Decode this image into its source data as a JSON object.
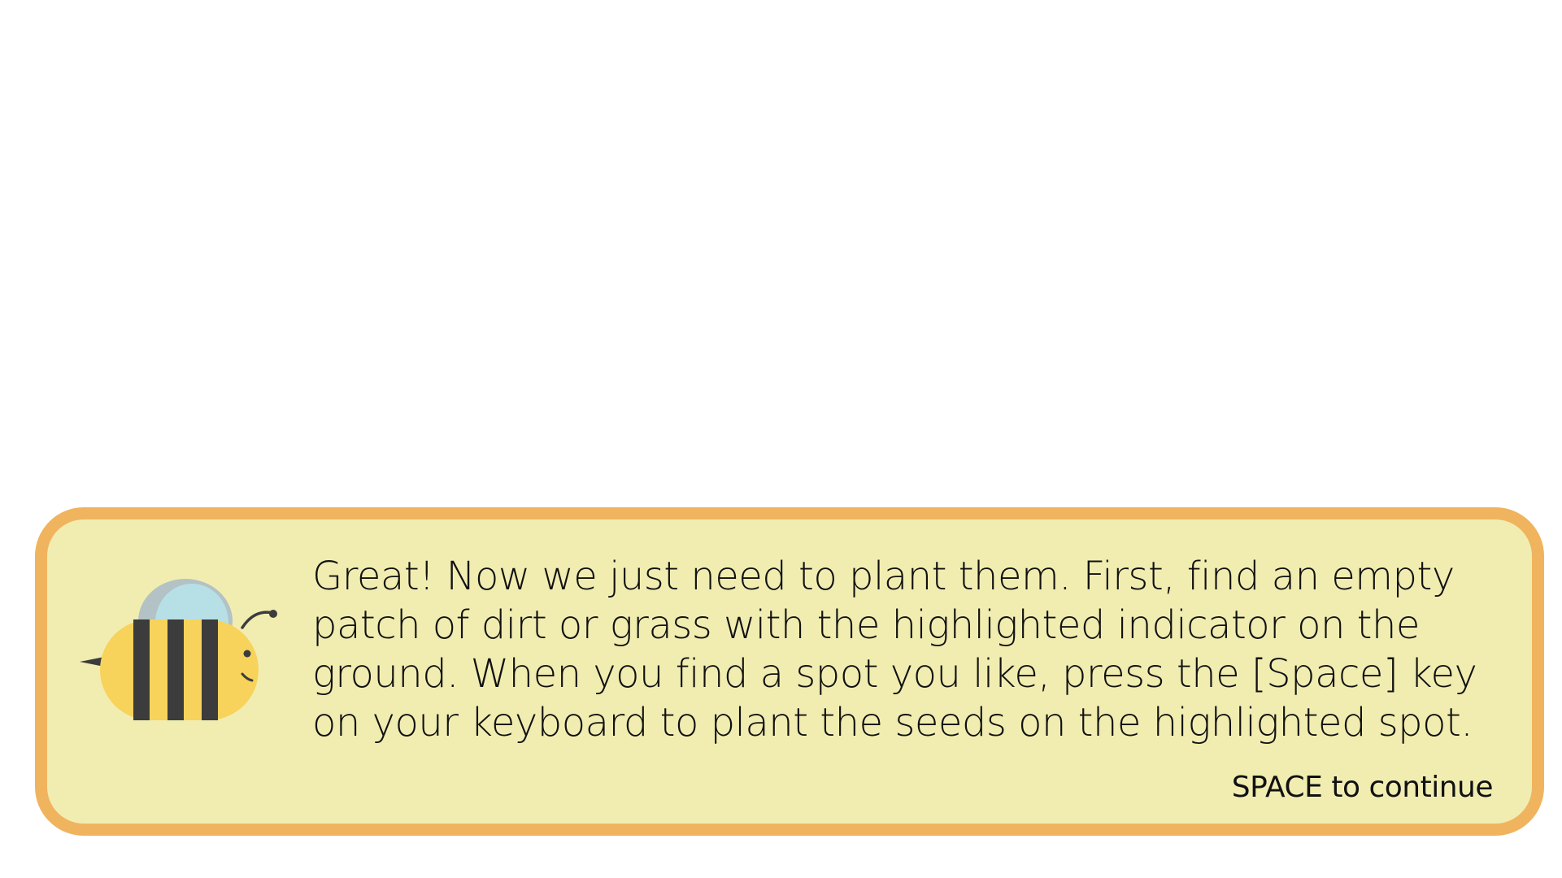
{
  "dialog": {
    "message": "Great! Now we just need to plant them. First, find an empty patch of dirt or grass with the highlighted indicator on the ground. When you find a spot you like, press the [Space] key on your keyboard to plant the seeds on the highlighted spot.",
    "continue_hint": "SPACE to continue",
    "speaker_icon": "bee-icon"
  },
  "colors": {
    "background": "#ffffff",
    "dialog_fill": "#f1edb1",
    "dialog_border": "#f0b45e",
    "bee_body": "#f7d35b",
    "bee_stripes": "#3c3c3c",
    "bee_wing_front": "#b7e0e6",
    "bee_wing_back": "#b3c2c4",
    "text": "#111111"
  }
}
